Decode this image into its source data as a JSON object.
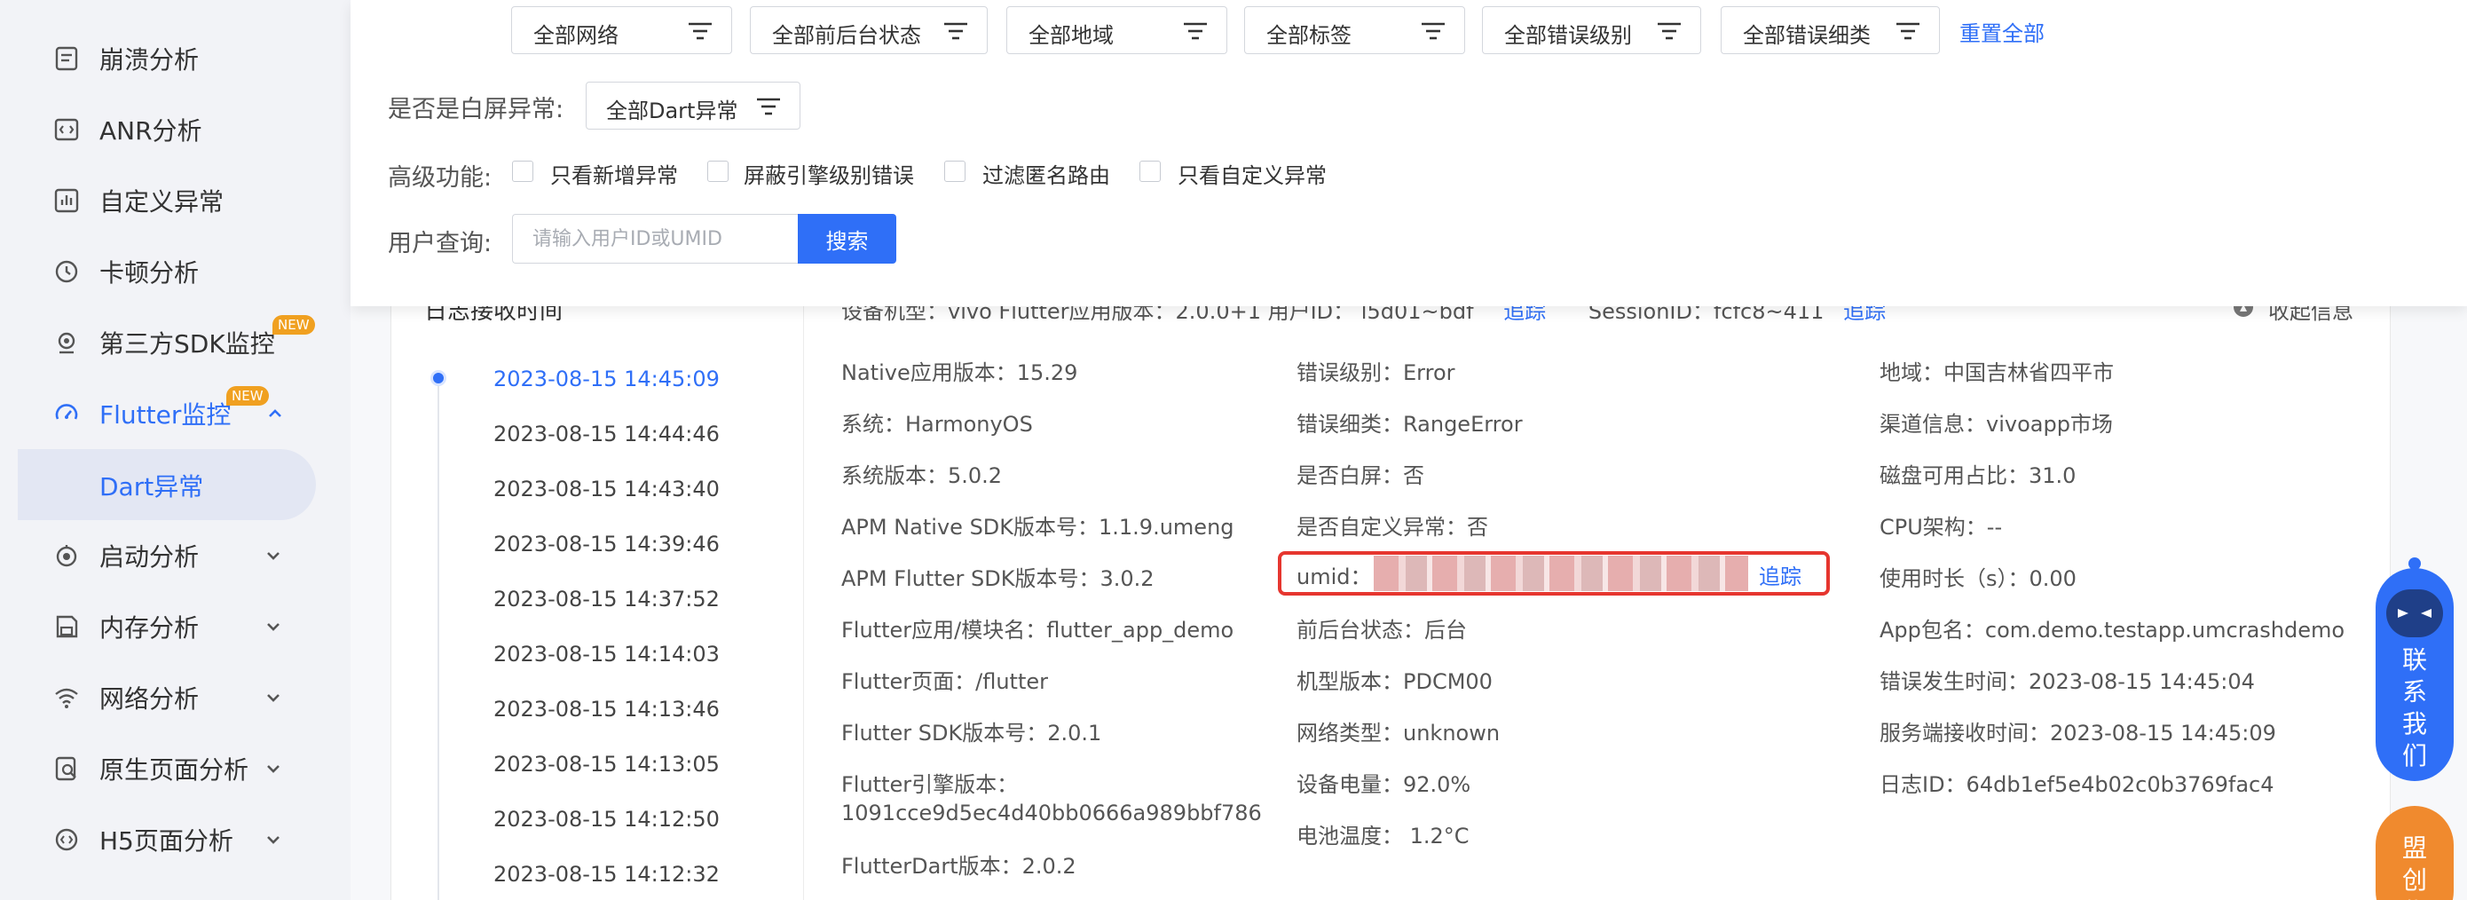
{
  "sidebar": {
    "items": [
      {
        "label": "崩溃分析",
        "icon": "crash-report-icon"
      },
      {
        "label": "ANR分析",
        "icon": "anr-icon"
      },
      {
        "label": "自定义异常",
        "icon": "custom-exception-icon"
      },
      {
        "label": "卡顿分析",
        "icon": "lag-clock-icon"
      },
      {
        "label": "第三方SDK监控",
        "icon": "third-party-sdk-icon",
        "badge": "NEW"
      },
      {
        "label": "Flutter监控",
        "icon": "flutter-dashboard-icon",
        "badge": "NEW",
        "expanded": true
      },
      {
        "label": "启动分析",
        "icon": "startup-icon"
      },
      {
        "label": "内存分析",
        "icon": "memory-save-icon"
      },
      {
        "label": "网络分析",
        "icon": "wifi-icon"
      },
      {
        "label": "原生页面分析",
        "icon": "native-page-icon"
      },
      {
        "label": "H5页面分析",
        "icon": "h5-page-icon"
      }
    ],
    "sub_item": "Dart异常"
  },
  "filters": {
    "dropdowns": [
      "全部网络",
      "全部前后台状态",
      "全部地域",
      "全部标签",
      "全部错误级别",
      "全部错误细类"
    ],
    "reset_label": "重置全部",
    "white_screen_label": "是否是白屏异常:",
    "dart_dropdown": "全部Dart异常",
    "advanced_label": "高级功能:",
    "checkboxes": [
      "只看新增异常",
      "屏蔽引擎级别错误",
      "过滤匿名路由",
      "只看自定义异常"
    ],
    "user_query_label": "用户查询:",
    "user_input_placeholder": "请输入用户ID或UMID",
    "search_label": "搜索"
  },
  "log": {
    "title": "日志接收时间",
    "times": [
      "2023-08-15 14:45:09",
      "2023-08-15 14:44:46",
      "2023-08-15 14:43:40",
      "2023-08-15 14:39:46",
      "2023-08-15 14:37:52",
      "2023-08-15 14:14:03",
      "2023-08-15 14:13:46",
      "2023-08-15 14:13:05",
      "2023-08-15 14:12:50",
      "2023-08-15 14:12:32"
    ]
  },
  "detail": {
    "partial_row": "设备机型：vivo    Flutter应用版本：2.0.0+1    用户ID：",
    "partial_user": "l5d01~bdf",
    "partial_track": "追踪",
    "partial_session": "SessionID：fcfc8~411",
    "partial_session_track": "追踪",
    "collapse_label": "收起信息",
    "col1": [
      "Native应用版本：15.29",
      "系统：HarmonyOS",
      "系统版本：5.0.2",
      "APM Native SDK版本号：1.1.9.umeng",
      "APM Flutter SDK版本号：3.0.2",
      "Flutter应用/模块名：flutter_app_demo",
      "Flutter页面：/flutter",
      "Flutter SDK版本号：2.0.1",
      "Flutter引擎版本：",
      "1091cce9d5ec4d40bb0666a989bbf786",
      "FlutterDart版本：2.0.2"
    ],
    "col2": [
      "错误级别：Error",
      "错误细类：RangeError",
      "是否白屏：否",
      "是否自定义异常：否",
      "前后台状态：后台",
      "机型版本：PDCM00",
      "网络类型：unknown",
      "设备电量：92.0%",
      "电池温度： 1.2°C"
    ],
    "umid_label": "umid：",
    "umid_track": "追踪",
    "col3": [
      "地域：中国吉林省四平市",
      "渠道信息：vivoapp市场",
      "磁盘可用占比：31.0",
      "CPU架构：--",
      "使用时长（s）：0.00",
      "App包名：com.demo.testapp.umcrashdemo",
      "错误发生时间：2023-08-15 14:45:04",
      "服务端接收时间：2023-08-15 14:45:09",
      "日志ID：64db1ef5e4b02c0b3769fac4"
    ]
  },
  "floating": {
    "contact_text": "联系我们",
    "alliance_text": "盟创优"
  },
  "colors": {
    "accent": "#2f6ff7",
    "highlight_border": "#e6362f",
    "badge": "#f0a020",
    "alliance": "#f08a2e"
  }
}
